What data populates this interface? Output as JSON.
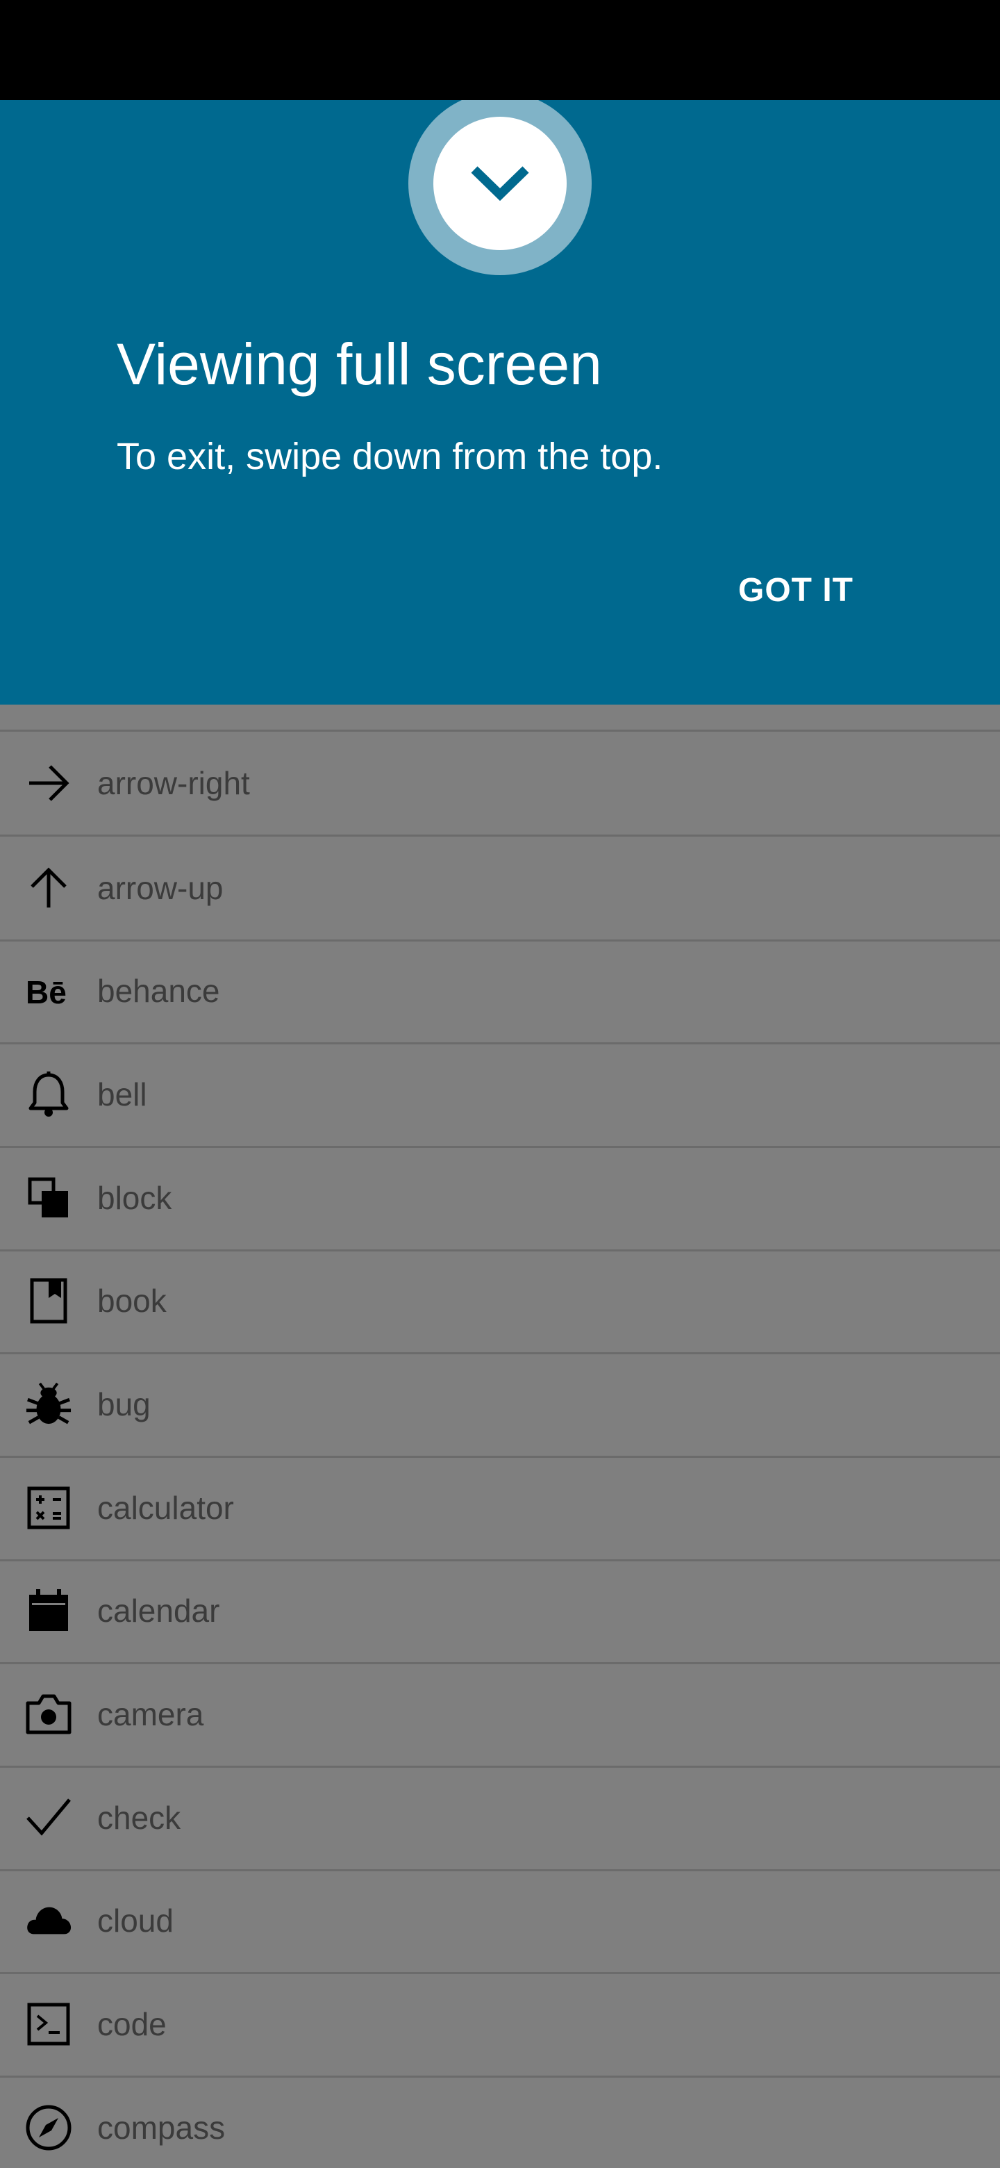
{
  "banner": {
    "title": "Viewing full screen",
    "body": "To exit, swipe down from the top.",
    "button_label": "GOT IT",
    "color": "#00698f"
  },
  "list": {
    "items": [
      {
        "label": "arrow-right",
        "icon": "arrow-right-icon"
      },
      {
        "label": "arrow-up",
        "icon": "arrow-up-icon"
      },
      {
        "label": "behance",
        "icon": "behance-icon"
      },
      {
        "label": "bell",
        "icon": "bell-icon"
      },
      {
        "label": "block",
        "icon": "block-icon"
      },
      {
        "label": "book",
        "icon": "book-icon"
      },
      {
        "label": "bug",
        "icon": "bug-icon"
      },
      {
        "label": "calculator",
        "icon": "calculator-icon"
      },
      {
        "label": "calendar",
        "icon": "calendar-icon"
      },
      {
        "label": "camera",
        "icon": "camera-icon"
      },
      {
        "label": "check",
        "icon": "check-icon"
      },
      {
        "label": "cloud",
        "icon": "cloud-icon"
      },
      {
        "label": "code",
        "icon": "code-icon"
      },
      {
        "label": "compass",
        "icon": "compass-icon"
      }
    ]
  }
}
